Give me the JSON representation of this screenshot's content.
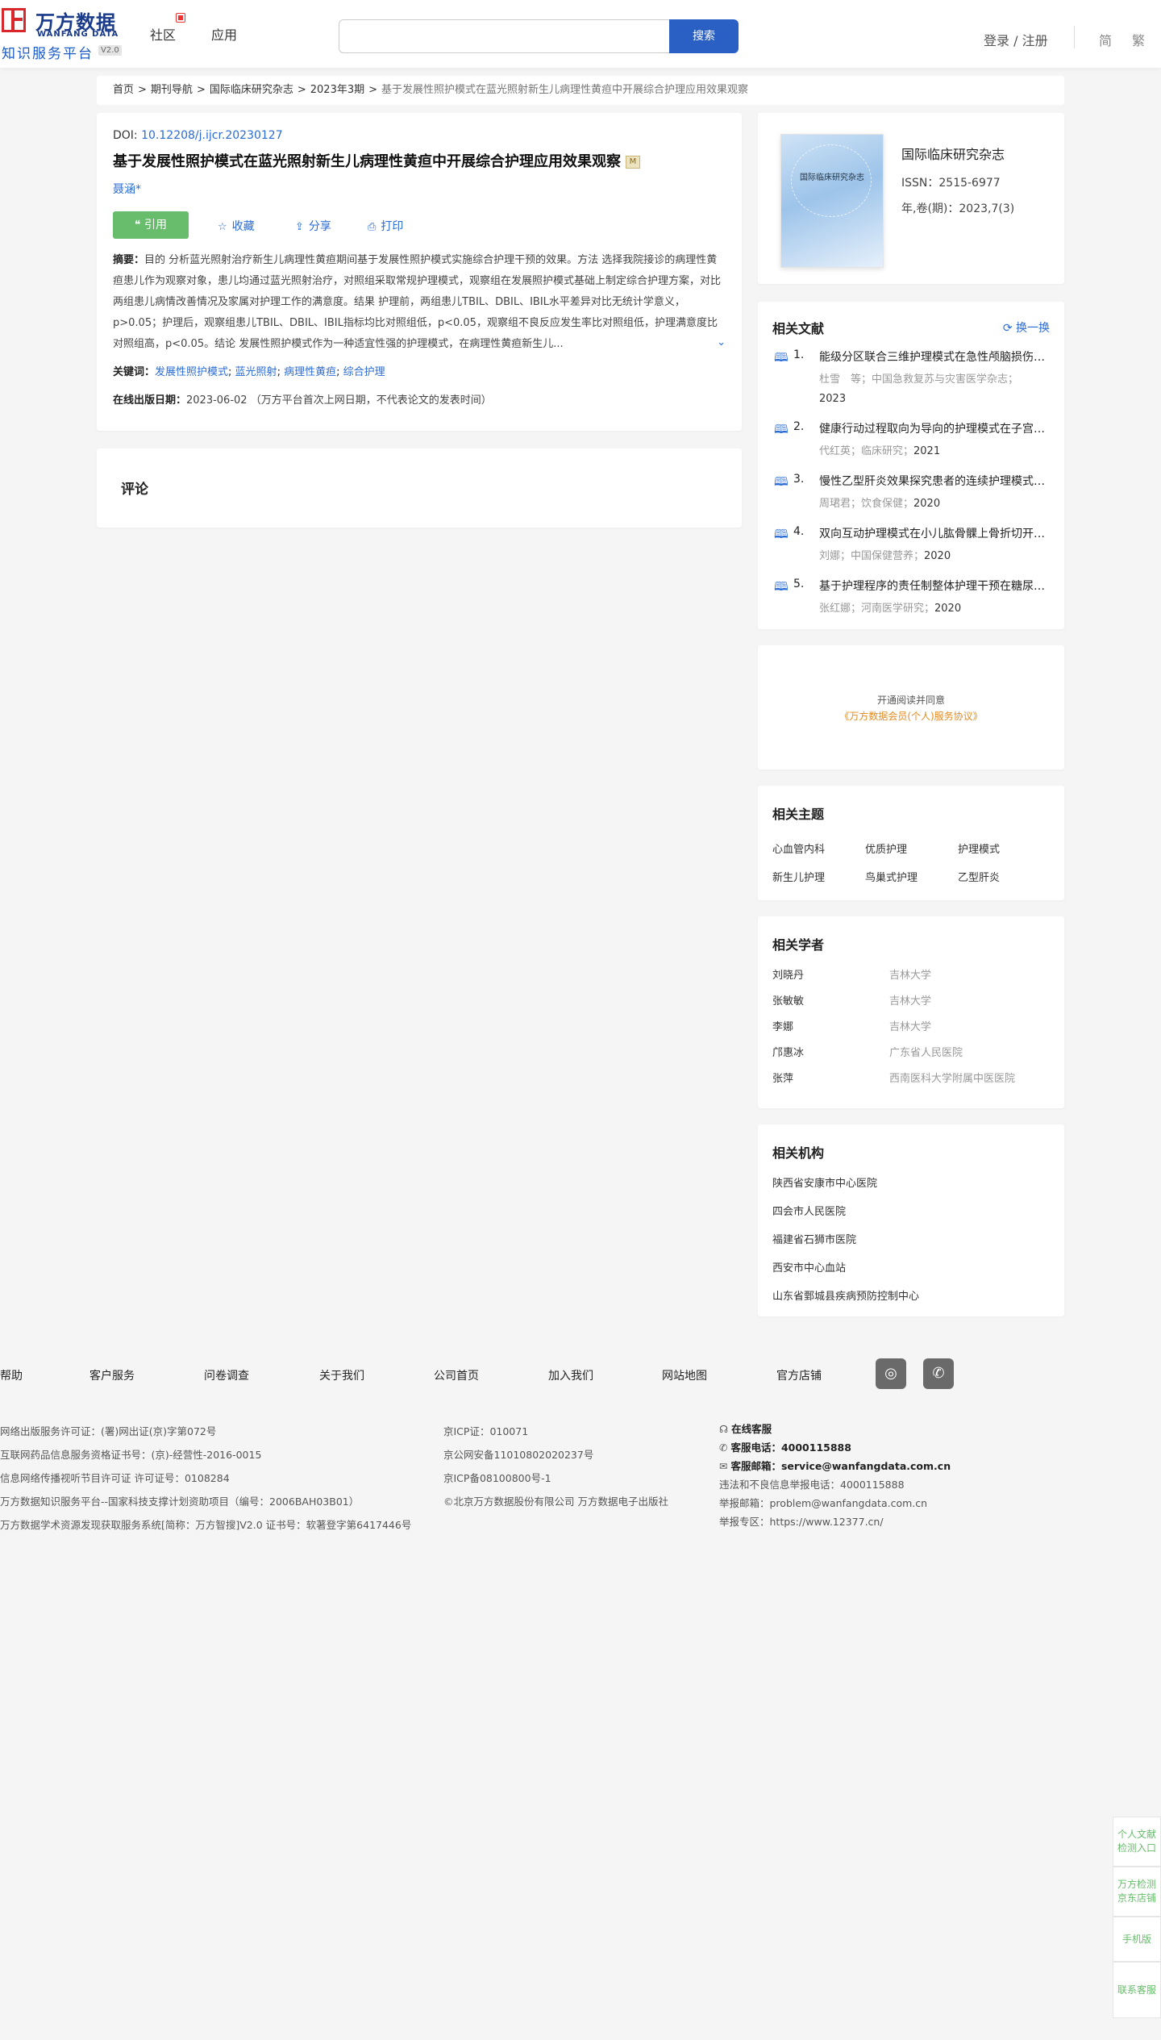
{
  "header": {
    "logo_cn": "万方数据",
    "logo_en": "WANFANG DATA",
    "logo_sub": "知识服务平台",
    "logo_ver": "V2.0",
    "nav": [
      "社区",
      "应用"
    ],
    "search_placeholder": "",
    "search_button": "搜索",
    "login": "登录 / 注册",
    "lang_simplified": "简",
    "lang_traditional": "繁"
  },
  "breadcrumb": {
    "items": [
      "首页",
      "期刊导航",
      "国际临床研究杂志",
      "2023年3期"
    ],
    "current": "基于发展性照护模式在蓝光照射新生儿病理性黄疸中开展综合护理应用效果观察"
  },
  "article": {
    "doi_label": "DOI: ",
    "doi": "10.12208/j.ijcr.20230127",
    "title": "基于发展性照护模式在蓝光照射新生儿病理性黄疸中开展综合护理应用效果观察",
    "title_mark": "M",
    "author": "聂涵*",
    "cite": "引用",
    "favorite": "收藏",
    "share": "分享",
    "print": "打印",
    "abstract_label": "摘要：",
    "abstract": "目的 分析蓝光照射治疗新生儿病理性黄疸期间基于发展性照护模式实施综合护理干预的效果。方法 选择我院接诊的病理性黄疸患儿作为观察对象，患儿均通过蓝光照射治疗，对照组采取常规护理模式，观察组在发展照护模式基础上制定综合护理方案，对比两组患儿病情改善情况及家属对护理工作的满意度。结果 护理前，两组患儿TBIL、DBIL、IBIL水平差异对比无统计学意义，p>0.05；护理后，观察组患儿TBIL、DBIL、IBIL指标均比对照组低，p<0.05，观察组不良反应发生率比对照组低，护理满意度比对照组高，p<0.05。结论 发展性照护模式作为一种适宜性强的护理模式，在病理性黄疸新生儿...",
    "expand_icon": "chevron-down-icon",
    "keywords_label": "关键词：",
    "keywords": [
      "发展性照护模式",
      "蓝光照射",
      "病理性黄疸",
      "综合护理"
    ],
    "date_label": "在线出版日期：",
    "date": "2023-06-02",
    "date_note": "（万方平台首次上网日期，不代表论文的发表时间）"
  },
  "comment": {
    "title": "评论"
  },
  "journal": {
    "cover_title": "国际临床研究杂志",
    "name": "国际临床研究杂志",
    "issn": "ISSN：2515-6977",
    "volume": "年,卷(期)：2023,7(3)"
  },
  "related_docs": {
    "title": "相关文献",
    "refresh": "换一换",
    "items": [
      {
        "num": "1.",
        "title": "能级分区联合三维护理模式在急性颅脑损伤患者中的应用",
        "meta": "杜雪　等；中国急救复苏与灾害医学杂志；",
        "year": "2023"
      },
      {
        "num": "2.",
        "title": "健康行动过程取向为导向的护理模式在子宫切除术患者中的应用",
        "meta": "代红英；临床研究；",
        "year": "2021"
      },
      {
        "num": "3.",
        "title": "慢性乙型肝炎效果探究患者的连续护理模式应用",
        "meta": "周珺君；饮食保健；",
        "year": "2020"
      },
      {
        "num": "4.",
        "title": "双向互动护理模式在小儿肱骨髁上骨折切开复位中的应用",
        "meta": "刘娜；中国保健营养；",
        "year": "2020"
      },
      {
        "num": "5.",
        "title": "基于护理程序的责任制整体护理干预在糖尿病患者中的应用",
        "meta": "张红娜；河南医学研究；",
        "year": "2020"
      }
    ]
  },
  "agreement": {
    "line1": "开通阅读并同意",
    "line2": "《万方数据会员(个人)服务协议》"
  },
  "topics": {
    "title": "相关主题",
    "items": [
      "心血管内科",
      "优质护理",
      "护理模式",
      "新生儿护理",
      "鸟巢式护理",
      "乙型肝炎"
    ]
  },
  "scholars": {
    "title": "相关学者",
    "items": [
      {
        "name": "刘晓丹",
        "org": "吉林大学"
      },
      {
        "name": "张敏敏",
        "org": "吉林大学"
      },
      {
        "name": "李娜",
        "org": "吉林大学"
      },
      {
        "name": "邝惠冰",
        "org": "广东省人民医院"
      },
      {
        "name": "张萍",
        "org": "西南医科大学附属中医医院"
      }
    ]
  },
  "orgs": {
    "title": "相关机构",
    "items": [
      "陕西省安康市中心医院",
      "四会市人民医院",
      "福建省石狮市医院",
      "西安市中心血站",
      "山东省鄄城县疾病预防控制中心"
    ]
  },
  "footer": {
    "nav": [
      "帮助",
      "客户服务",
      "问卷调查",
      "关于我们",
      "公司首页",
      "加入我们",
      "网站地图",
      "官方店铺"
    ],
    "col1": [
      "网络出版服务许可证：(署)网出证(京)字第072号",
      "互联网药品信息服务资格证书号：(京)-经营性-2016-0015",
      "信息网络传播视听节目许可证 许可证号：0108284",
      "万方数据知识服务平台--国家科技支撑计划资助项目（编号：2006BAH03B01）",
      "万方数据学术资源发现获取服务系统[简称：万方智搜]V2.0 证书号：软著登字第6417446号"
    ],
    "col2": [
      "京ICP证：010071",
      "京公网安备11010802020237号",
      "京ICP备08100800号-1",
      "©北京万方数据股份有限公司 万方数据电子出版社"
    ],
    "online_service": "在线客服",
    "phone_label": "客服电话：",
    "phone": "4000115888",
    "email_label": "客服邮箱：",
    "email": "service@wanfangdata.com.cn",
    "report_phone": "违法和不良信息举报电话：4000115888",
    "report_email": "举报邮箱：problem@wanfangdata.com.cn",
    "report_zone": "举报专区：https://www.12377.cn/"
  },
  "float": [
    "个人文献检测入口",
    "万方检测京东店铺",
    "手机版",
    "联系客服"
  ],
  "colors": {
    "primary": "#2a5fc3",
    "green": "#67bd6b",
    "brand_red": "#d8282c",
    "orange": "#e58a1e"
  }
}
